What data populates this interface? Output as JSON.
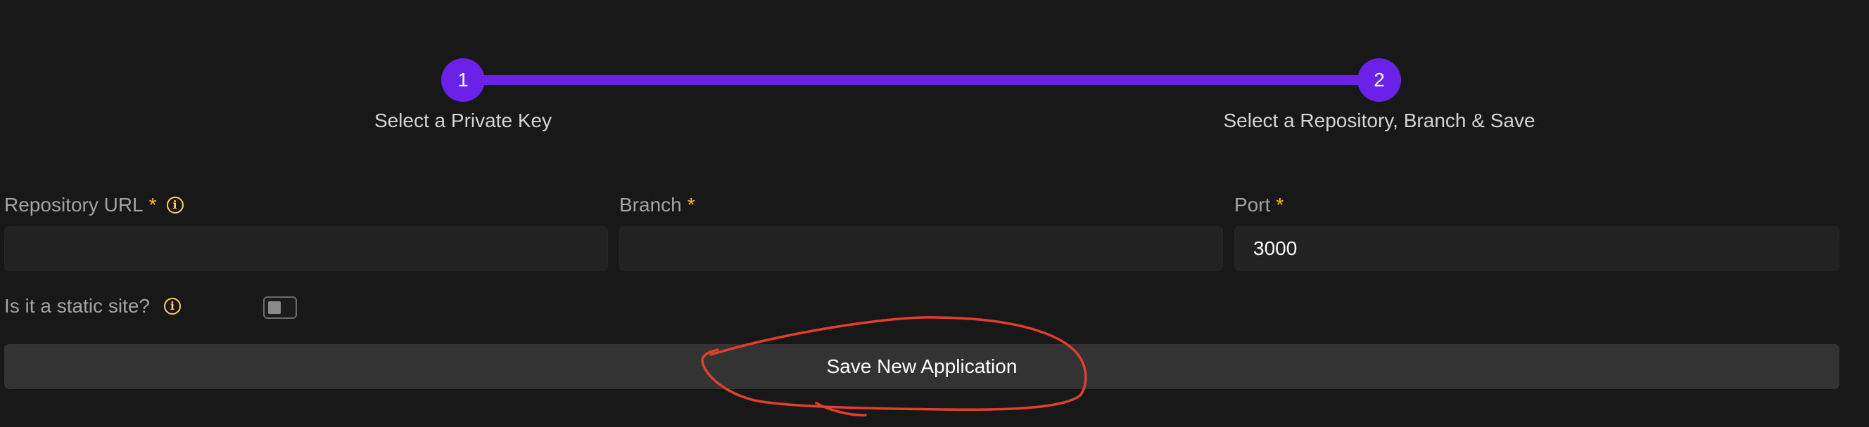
{
  "stepper": {
    "steps": [
      {
        "number": "1",
        "label": "Select a Private Key"
      },
      {
        "number": "2",
        "label": "Select a Repository, Branch & Save"
      }
    ],
    "accent_color": "#6b21e8"
  },
  "form": {
    "repository_url": {
      "label": "Repository URL",
      "required": "*",
      "value": "",
      "icon": "info-icon"
    },
    "branch": {
      "label": "Branch",
      "required": "*",
      "value": ""
    },
    "port": {
      "label": "Port",
      "required": "*",
      "value": "3000"
    },
    "static_site": {
      "label": "Is it a static site?",
      "icon": "info-icon",
      "checked": false
    },
    "info_icon_glyph": "i",
    "required_color": "#fbbf24"
  },
  "actions": {
    "save_label": "Save New Application"
  },
  "annotation": {
    "shape": "hand-drawn circle",
    "color": "#e0402a"
  }
}
